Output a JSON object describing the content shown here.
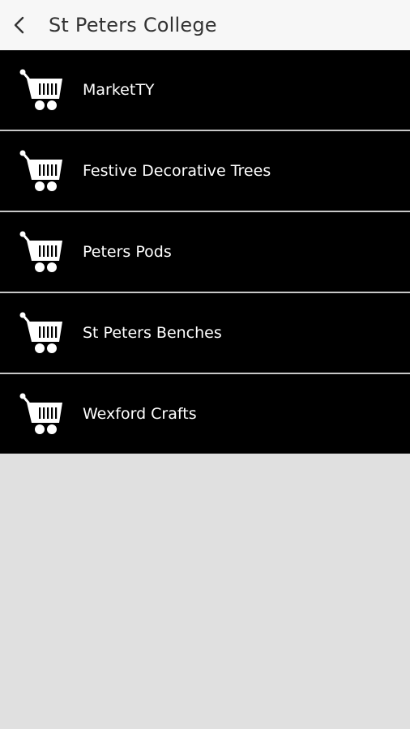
{
  "header": {
    "title": "St Peters College",
    "back_icon": "back-arrow-icon"
  },
  "items": [
    {
      "label": "MarketTY",
      "icon": "shopping-cart-icon"
    },
    {
      "label": "Festive Decorative Trees",
      "icon": "shopping-cart-icon"
    },
    {
      "label": "Peters Pods",
      "icon": "shopping-cart-icon"
    },
    {
      "label": "St Peters Benches",
      "icon": "shopping-cart-icon"
    },
    {
      "label": "Wexford Crafts",
      "icon": "shopping-cart-icon"
    }
  ],
  "colors": {
    "header_bg": "#f7f7f7",
    "item_bg": "#000000",
    "item_text": "#ffffff",
    "page_bg": "#e0e0e0"
  }
}
